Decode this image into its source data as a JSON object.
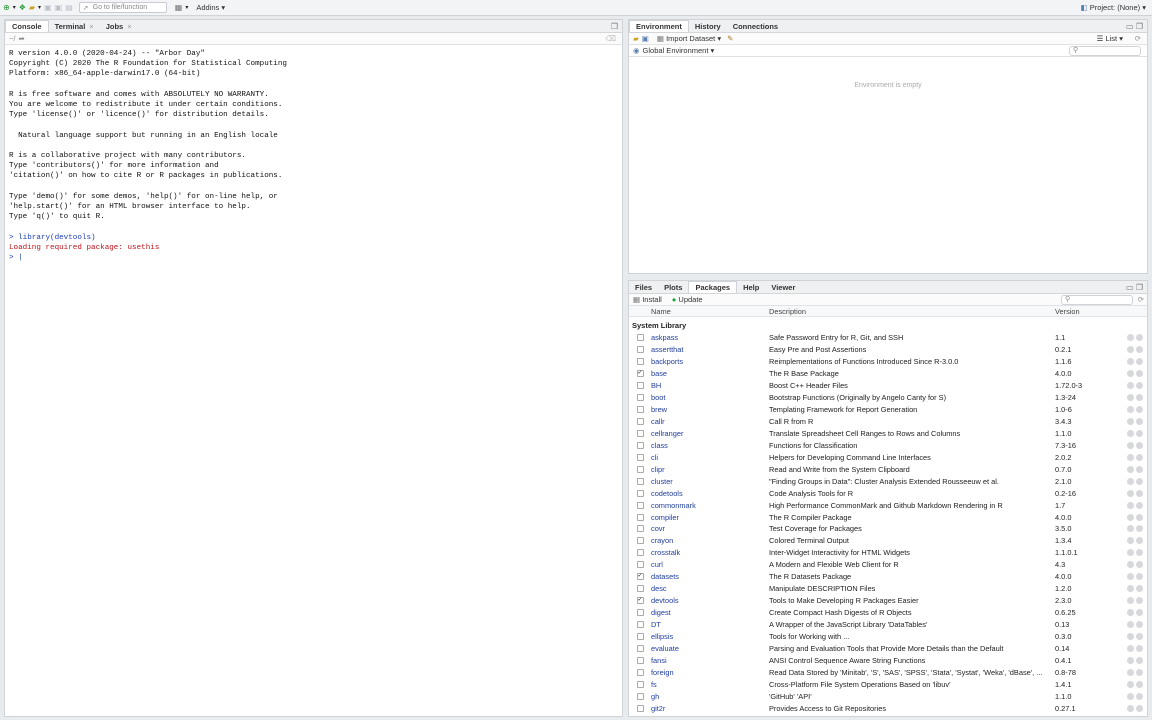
{
  "toolbar": {
    "goto_placeholder": "Go to file/function",
    "addins": "Addins",
    "project": "Project: (None)"
  },
  "console": {
    "tabs": [
      {
        "label": "Console"
      },
      {
        "label": "Terminal"
      },
      {
        "label": "Jobs"
      }
    ],
    "path": "~/",
    "lines": [
      "R version 4.0.0 (2020-04-24) -- \"Arbor Day\"",
      "Copyright (C) 2020 The R Foundation for Statistical Computing",
      "Platform: x86_64-apple-darwin17.0 (64-bit)",
      "",
      "R is free software and comes with ABSOLUTELY NO WARRANTY.",
      "You are welcome to redistribute it under certain conditions.",
      "Type 'license()' or 'licence()' for distribution details.",
      "",
      "  Natural language support but running in an English locale",
      "",
      "R is a collaborative project with many contributors.",
      "Type 'contributors()' for more information and",
      "'citation()' on how to cite R or R packages in publications.",
      "",
      "Type 'demo()' for some demos, 'help()' for on-line help, or",
      "'help.start()' for an HTML browser interface to help.",
      "Type 'q()' to quit R.",
      ""
    ],
    "command": "> library(devtools)",
    "message": "Loading required package: usethis",
    "prompt": "> |"
  },
  "environment": {
    "tabs": [
      {
        "label": "Environment"
      },
      {
        "label": "History"
      },
      {
        "label": "Connections"
      }
    ],
    "import_dataset": "Import Dataset",
    "list_view": "List",
    "scope": "Global Environment",
    "empty_message": "Environment is empty"
  },
  "packages": {
    "tabs": [
      {
        "label": "Files"
      },
      {
        "label": "Plots"
      },
      {
        "label": "Packages"
      },
      {
        "label": "Help"
      },
      {
        "label": "Viewer"
      }
    ],
    "install": "Install",
    "update": "Update",
    "columns": {
      "name": "Name",
      "description": "Description",
      "version": "Version"
    },
    "section": "System Library",
    "rows": [
      {
        "name": "askpass",
        "desc": "Safe Password Entry for R, Git, and SSH",
        "version": "1.1",
        "checked": false
      },
      {
        "name": "assertthat",
        "desc": "Easy Pre and Post Assertions",
        "version": "0.2.1",
        "checked": false
      },
      {
        "name": "backports",
        "desc": "Reimplementations of Functions Introduced Since R-3.0.0",
        "version": "1.1.6",
        "checked": false
      },
      {
        "name": "base",
        "desc": "The R Base Package",
        "version": "4.0.0",
        "checked": true
      },
      {
        "name": "BH",
        "desc": "Boost C++ Header Files",
        "version": "1.72.0-3",
        "checked": false
      },
      {
        "name": "boot",
        "desc": "Bootstrap Functions (Originally by Angelo Canty for S)",
        "version": "1.3-24",
        "checked": false
      },
      {
        "name": "brew",
        "desc": "Templating Framework for Report Generation",
        "version": "1.0-6",
        "checked": false
      },
      {
        "name": "callr",
        "desc": "Call R from R",
        "version": "3.4.3",
        "checked": false
      },
      {
        "name": "cellranger",
        "desc": "Translate Spreadsheet Cell Ranges to Rows and Columns",
        "version": "1.1.0",
        "checked": false
      },
      {
        "name": "class",
        "desc": "Functions for Classification",
        "version": "7.3-16",
        "checked": false
      },
      {
        "name": "cli",
        "desc": "Helpers for Developing Command Line Interfaces",
        "version": "2.0.2",
        "checked": false
      },
      {
        "name": "clipr",
        "desc": "Read and Write from the System Clipboard",
        "version": "0.7.0",
        "checked": false
      },
      {
        "name": "cluster",
        "desc": "\"Finding Groups in Data\": Cluster Analysis Extended Rousseeuw et al.",
        "version": "2.1.0",
        "checked": false
      },
      {
        "name": "codetools",
        "desc": "Code Analysis Tools for R",
        "version": "0.2-16",
        "checked": false
      },
      {
        "name": "commonmark",
        "desc": "High Performance CommonMark and Github Markdown Rendering in R",
        "version": "1.7",
        "checked": false
      },
      {
        "name": "compiler",
        "desc": "The R Compiler Package",
        "version": "4.0.0",
        "checked": false
      },
      {
        "name": "covr",
        "desc": "Test Coverage for Packages",
        "version": "3.5.0",
        "checked": false
      },
      {
        "name": "crayon",
        "desc": "Colored Terminal Output",
        "version": "1.3.4",
        "checked": false
      },
      {
        "name": "crosstalk",
        "desc": "Inter-Widget Interactivity for HTML Widgets",
        "version": "1.1.0.1",
        "checked": false
      },
      {
        "name": "curl",
        "desc": "A Modern and Flexible Web Client for R",
        "version": "4.3",
        "checked": false
      },
      {
        "name": "datasets",
        "desc": "The R Datasets Package",
        "version": "4.0.0",
        "checked": true
      },
      {
        "name": "desc",
        "desc": "Manipulate DESCRIPTION Files",
        "version": "1.2.0",
        "checked": false
      },
      {
        "name": "devtools",
        "desc": "Tools to Make Developing R Packages Easier",
        "version": "2.3.0",
        "checked": true
      },
      {
        "name": "digest",
        "desc": "Create Compact Hash Digests of R Objects",
        "version": "0.6.25",
        "checked": false
      },
      {
        "name": "DT",
        "desc": "A Wrapper of the JavaScript Library 'DataTables'",
        "version": "0.13",
        "checked": false
      },
      {
        "name": "ellipsis",
        "desc": "Tools for Working with ...",
        "version": "0.3.0",
        "checked": false
      },
      {
        "name": "evaluate",
        "desc": "Parsing and Evaluation Tools that Provide More Details than the Default",
        "version": "0.14",
        "checked": false
      },
      {
        "name": "fansi",
        "desc": "ANSI Control Sequence Aware String Functions",
        "version": "0.4.1",
        "checked": false
      },
      {
        "name": "foreign",
        "desc": "Read Data Stored by 'Minitab', 'S', 'SAS', 'SPSS', 'Stata', 'Systat', 'Weka', 'dBase', ...",
        "version": "0.8-78",
        "checked": false
      },
      {
        "name": "fs",
        "desc": "Cross-Platform File System Operations Based on 'libuv'",
        "version": "1.4.1",
        "checked": false
      },
      {
        "name": "gh",
        "desc": "'GitHub' 'API'",
        "version": "1.1.0",
        "checked": false
      },
      {
        "name": "git2r",
        "desc": "Provides Access to Git Repositories",
        "version": "0.27.1",
        "checked": false
      }
    ]
  },
  "colors": {
    "link": "#1f3d9c",
    "console_input": "#1c3fb8",
    "console_message": "#c0141b",
    "update_icon": "#1aa33a"
  }
}
